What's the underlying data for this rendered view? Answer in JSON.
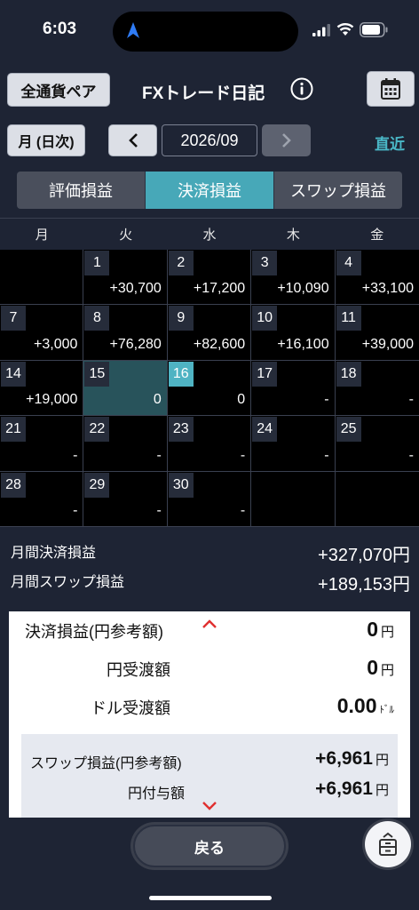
{
  "status_bar": {
    "time": "6:03"
  },
  "header": {
    "currency_button": "全通貨ペア",
    "title": "FXトレード日記"
  },
  "date_nav": {
    "period_button": "月 (日次)",
    "month": "2026/09",
    "recent_link": "直近"
  },
  "tabs": [
    {
      "label": "評価損益",
      "active": false
    },
    {
      "label": "決済損益",
      "active": true
    },
    {
      "label": "スワップ損益",
      "active": false
    }
  ],
  "calendar": {
    "weekdays": [
      "月",
      "火",
      "水",
      "木",
      "金"
    ],
    "cells": [
      {
        "day": "",
        "value": ""
      },
      {
        "day": "1",
        "value": "+30,700"
      },
      {
        "day": "2",
        "value": "+17,200"
      },
      {
        "day": "3",
        "value": "+10,090"
      },
      {
        "day": "4",
        "value": "+33,100"
      },
      {
        "day": "7",
        "value": "+3,000"
      },
      {
        "day": "8",
        "value": "+76,280"
      },
      {
        "day": "9",
        "value": "+82,600"
      },
      {
        "day": "10",
        "value": "+16,100"
      },
      {
        "day": "11",
        "value": "+39,000"
      },
      {
        "day": "14",
        "value": "+19,000"
      },
      {
        "day": "15",
        "value": "0",
        "today": true
      },
      {
        "day": "16",
        "value": "0",
        "selected": true
      },
      {
        "day": "17",
        "value": "-"
      },
      {
        "day": "18",
        "value": "-"
      },
      {
        "day": "21",
        "value": "-"
      },
      {
        "day": "22",
        "value": "-"
      },
      {
        "day": "23",
        "value": "-"
      },
      {
        "day": "24",
        "value": "-"
      },
      {
        "day": "25",
        "value": "-"
      },
      {
        "day": "28",
        "value": "-"
      },
      {
        "day": "29",
        "value": "-"
      },
      {
        "day": "30",
        "value": "-"
      },
      {
        "day": "",
        "value": ""
      },
      {
        "day": "",
        "value": ""
      }
    ]
  },
  "summary": {
    "settlement_label": "月間決済損益",
    "settlement_value": "+327,070円",
    "swap_label": "月間スワップ損益",
    "swap_value": "+189,153円"
  },
  "detail": {
    "settlement_label": "決済損益(円参考額)",
    "settlement_value": "0",
    "settlement_unit": "円",
    "yen_transfer_label": "円受渡額",
    "yen_transfer_value": "0",
    "yen_transfer_unit": "円",
    "dollar_transfer_label": "ドル受渡額",
    "dollar_transfer_value": "0.00",
    "dollar_transfer_unit": "ﾄﾞﾙ",
    "swap_label": "スワップ損益(円参考額)",
    "swap_value": "+6,961",
    "swap_unit": "円",
    "yen_grant_label": "円付与額",
    "yen_grant_value": "+6,961",
    "yen_grant_unit": "円"
  },
  "bottom": {
    "back_button": "戻る"
  },
  "colors": {
    "background": "#1e2434",
    "accent": "#47a8b8",
    "today_cell": "#28535b",
    "chevron": "#e03030"
  },
  "icons": [
    "navigation-arrow-icon",
    "signal-icon",
    "wifi-icon",
    "battery-icon",
    "info-icon",
    "calendar-icon",
    "chevron-left-icon",
    "chevron-right-icon",
    "chevron-up-icon",
    "chevron-down-icon",
    "menu-toggle-icon"
  ]
}
